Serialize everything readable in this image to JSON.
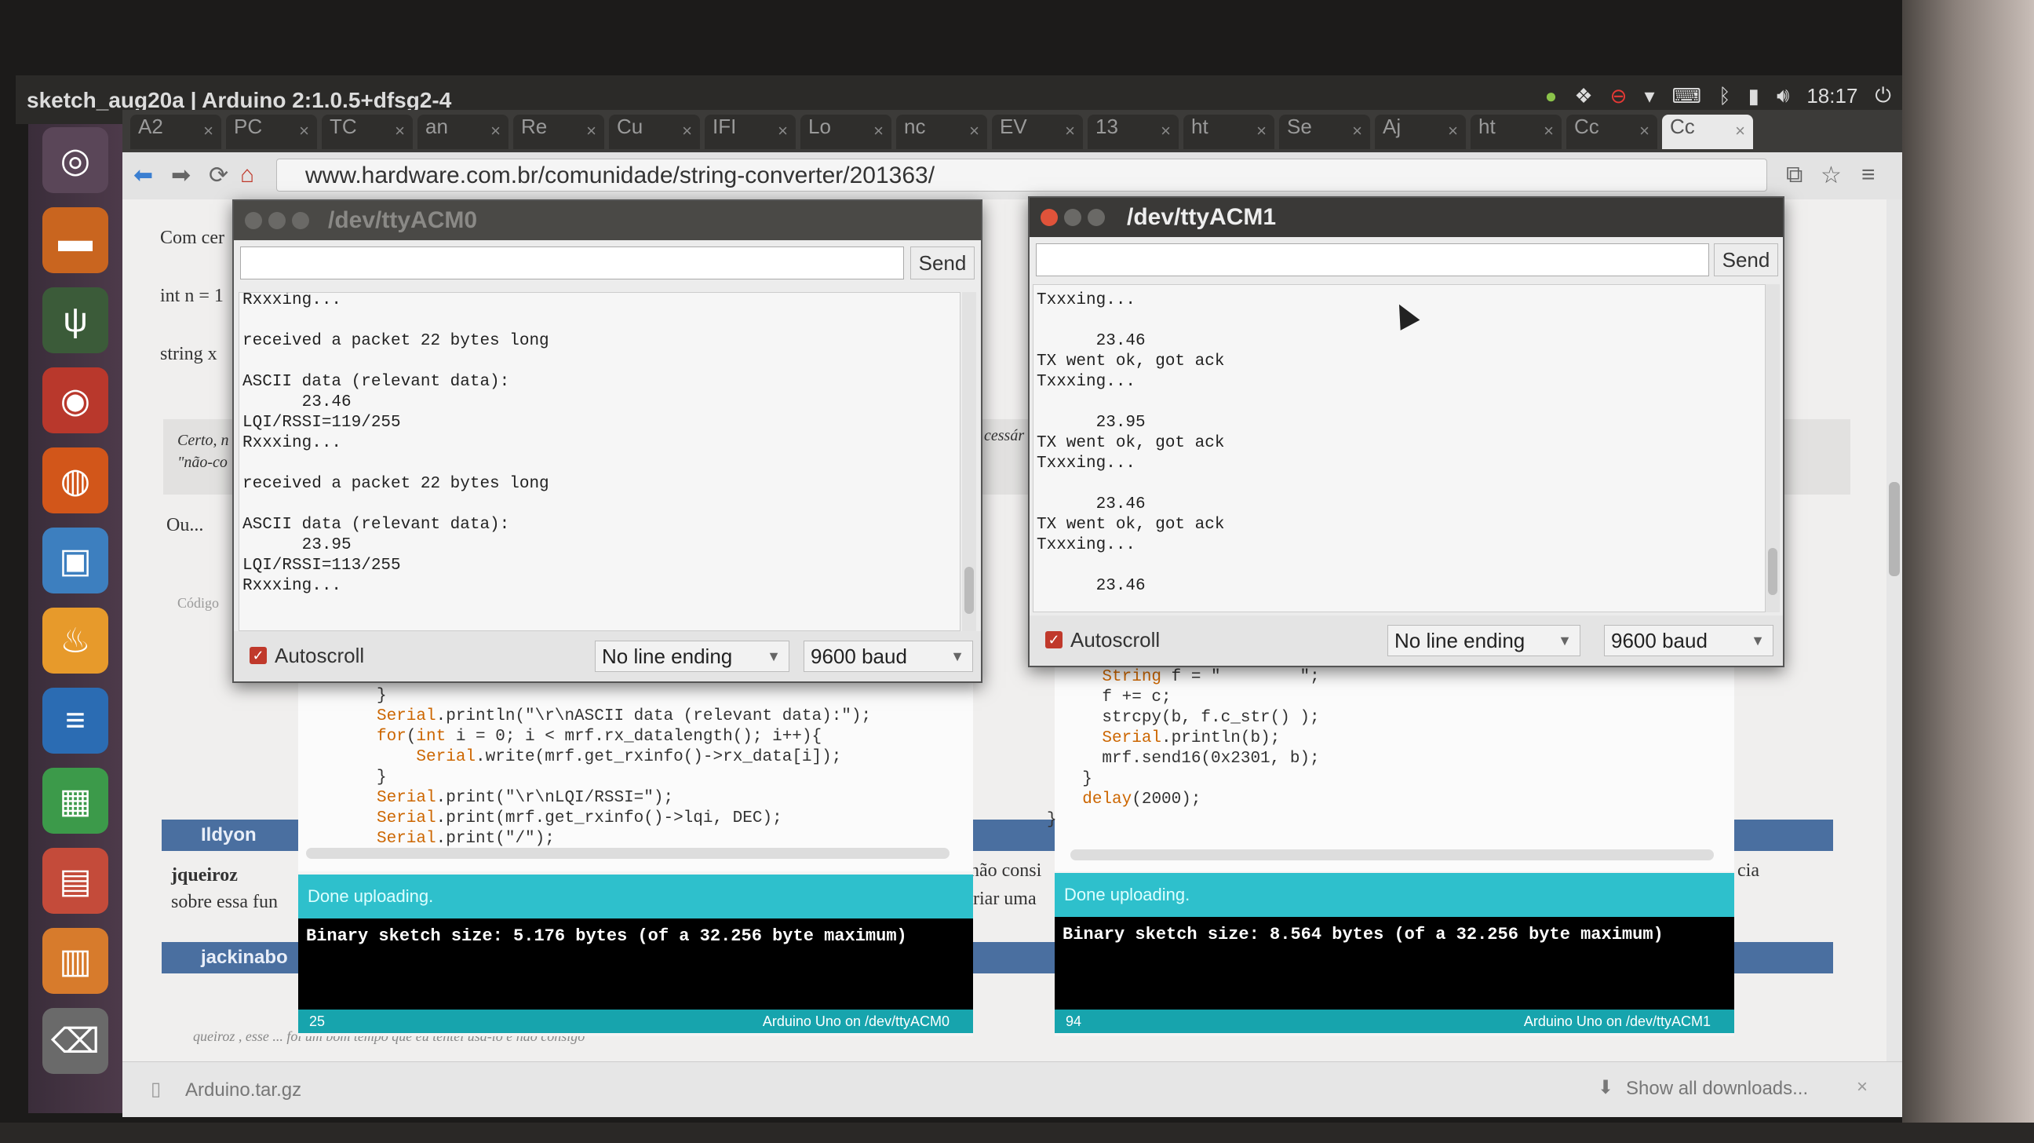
{
  "window_title": "sketch_aug20a | Arduino 2:1.0.5+dfsg2-4",
  "tray": {
    "time": "18:17"
  },
  "browser": {
    "tabs": [
      {
        "label": "A2"
      },
      {
        "label": "PC"
      },
      {
        "label": "TC"
      },
      {
        "label": "an"
      },
      {
        "label": "Re"
      },
      {
        "label": "Cu"
      },
      {
        "label": "IFI"
      },
      {
        "label": "Lo"
      },
      {
        "label": "nc"
      },
      {
        "label": "EV"
      },
      {
        "label": "13"
      },
      {
        "label": "ht"
      },
      {
        "label": "Se"
      },
      {
        "label": "Aj"
      },
      {
        "label": "ht"
      },
      {
        "label": "Cc"
      },
      {
        "label": "Cc"
      }
    ],
    "url": "www.hardware.com.br/comunidade/string-converter/201363/",
    "page_text": {
      "com_cer": "Com cer",
      "int_n": "int n = 1",
      "string_x": "string x",
      "certo": "Certo, n",
      "nao_co": "\"não-co",
      "ou": "Ou...",
      "codigo": "Código",
      "necessar": "cessár",
      "nao_consi": "não consi",
      "criar_uma": "riar uma",
      "cia": "cia",
      "user1": "Ildyon",
      "jqueiroz": "jqueiroz",
      "sobre_essa": "sobre essa fun",
      "user2": "jackinabo",
      "quote_line": "queiroz , esse ... foi um bom tempo que eu tentei usá-lo e não consigo"
    },
    "downloads": {
      "file": "Arduino.tar.gz",
      "show_all": "Show all downloads..."
    }
  },
  "serial_acm0": {
    "title": "/dev/ttyACM0",
    "send_label": "Send",
    "lines": [
      "Rxxxing...",
      "",
      "received a packet 22 bytes long",
      "",
      "ASCII data (relevant data):",
      "      23.46",
      "LQI/RSSI=119/255",
      "Rxxxing...",
      "",
      "received a packet 22 bytes long",
      "",
      "ASCII data (relevant data):",
      "      23.95",
      "LQI/RSSI=113/255",
      "Rxxxing..."
    ],
    "autoscroll": "Autoscroll",
    "line_ending": "No line ending",
    "baud": "9600 baud"
  },
  "serial_acm1": {
    "title": "/dev/ttyACM1",
    "send_label": "Send",
    "lines": [
      "Txxxing...",
      "",
      "      23.46",
      "TX went ok, got ack",
      "Txxxing...",
      "",
      "      23.95",
      "TX went ok, got ack",
      "Txxxing...",
      "",
      "      23.46",
      "TX went ok, got ack",
      "Txxxing...",
      "",
      "      23.46"
    ],
    "autoscroll": "Autoscroll",
    "line_ending": "No line ending",
    "baud": "9600 baud"
  },
  "ide_left": {
    "code": [
      "}",
      "Serial.println(\"\\r\\nASCII data (relevant data):\");",
      "for(int i = 0; i < mrf.rx_datalength(); i++){",
      "    Serial.write(mrf.get_rxinfo()->rx_data[i]);",
      "}",
      "Serial.print(\"\\r\\nLQI/RSSI=\");",
      "Serial.print(mrf.get_rxinfo()->lqi, DEC);",
      "Serial.print(\"/\");"
    ],
    "status": "Done uploading.",
    "console": "Binary sketch size: 5.176 bytes (of a 32.256 byte maximum)",
    "line_no": "25",
    "board": "Arduino Uno on /dev/ttyACM0"
  },
  "ide_right": {
    "code": [
      "    String f = \"        \";",
      "    f += c;",
      "    strcpy(b, f.c_str() );",
      "    Serial.println(b);",
      "    mrf.send16(0x2301, b);",
      "  }",
      "  delay(2000);",
      "}"
    ],
    "status": "Done uploading.",
    "console": "Binary sketch size: 8.564 bytes (of a 32.256 byte maximum)",
    "line_no": "94",
    "board": "Arduino Uno on /dev/ttyACM1"
  }
}
